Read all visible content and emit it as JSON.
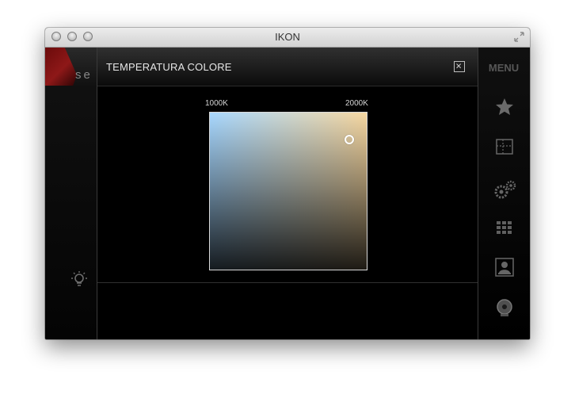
{
  "window": {
    "title": "IKON"
  },
  "app": {
    "logo_text": "se",
    "menu_label": "MENU"
  },
  "modal": {
    "title": "TEMPERATURA COLORE",
    "scale_min_label": "1000K",
    "scale_max_label": "2000K"
  },
  "icons": {
    "close": "close-icon",
    "lamp": "lamp-icon",
    "favorites": "star-icon",
    "layout": "layout-icon",
    "settings": "gear-icon",
    "grid": "grid-icon",
    "user": "user-icon",
    "camera": "camera-icon"
  },
  "colors": {
    "cool_tone": "#a8d8ff",
    "warm_tone": "#f6d7a1",
    "accent_red": "#8e1818",
    "panel_bg": "#000000"
  }
}
